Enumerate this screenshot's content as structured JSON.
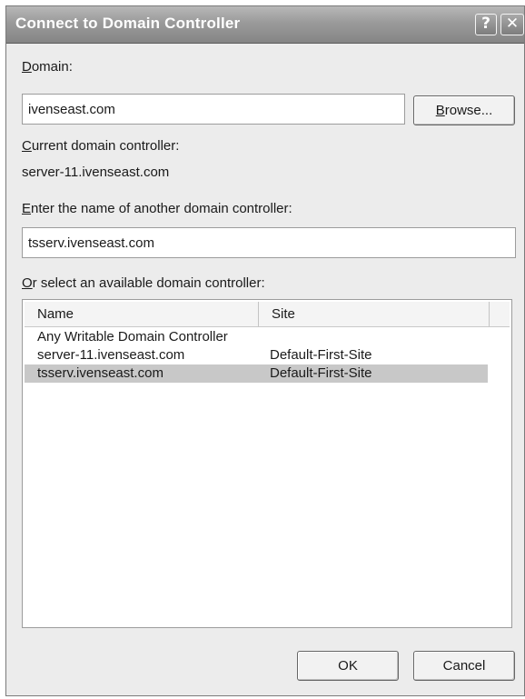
{
  "window": {
    "title": "Connect to Domain Controller",
    "help_glyph": "?",
    "close_glyph": "✕"
  },
  "domain": {
    "label_mnemonic": "D",
    "label_rest": "omain:",
    "value": "ivenseast.com",
    "browse_mnemonic": "B",
    "browse_rest": "rowse..."
  },
  "current_dc": {
    "label_mnemonic": "C",
    "label_rest": "urrent domain controller:",
    "value": "server-11.ivenseast.com"
  },
  "other_dc": {
    "label_mnemonic": "E",
    "label_rest": "nter the name of another domain controller:",
    "value": "tsserv.ivenseast.com"
  },
  "available_dc": {
    "label_mnemonic": "O",
    "label_rest": "r select an available domain controller:",
    "columns": [
      "Name",
      "Site"
    ],
    "rows": [
      {
        "name": "Any Writable Domain Controller",
        "site": ""
      },
      {
        "name": "server-11.ivenseast.com",
        "site": "Default-First-Site"
      },
      {
        "name": "tsserv.ivenseast.com",
        "site": "Default-First-Site",
        "selected": true
      }
    ]
  },
  "buttons": {
    "ok": "OK",
    "cancel": "Cancel"
  }
}
